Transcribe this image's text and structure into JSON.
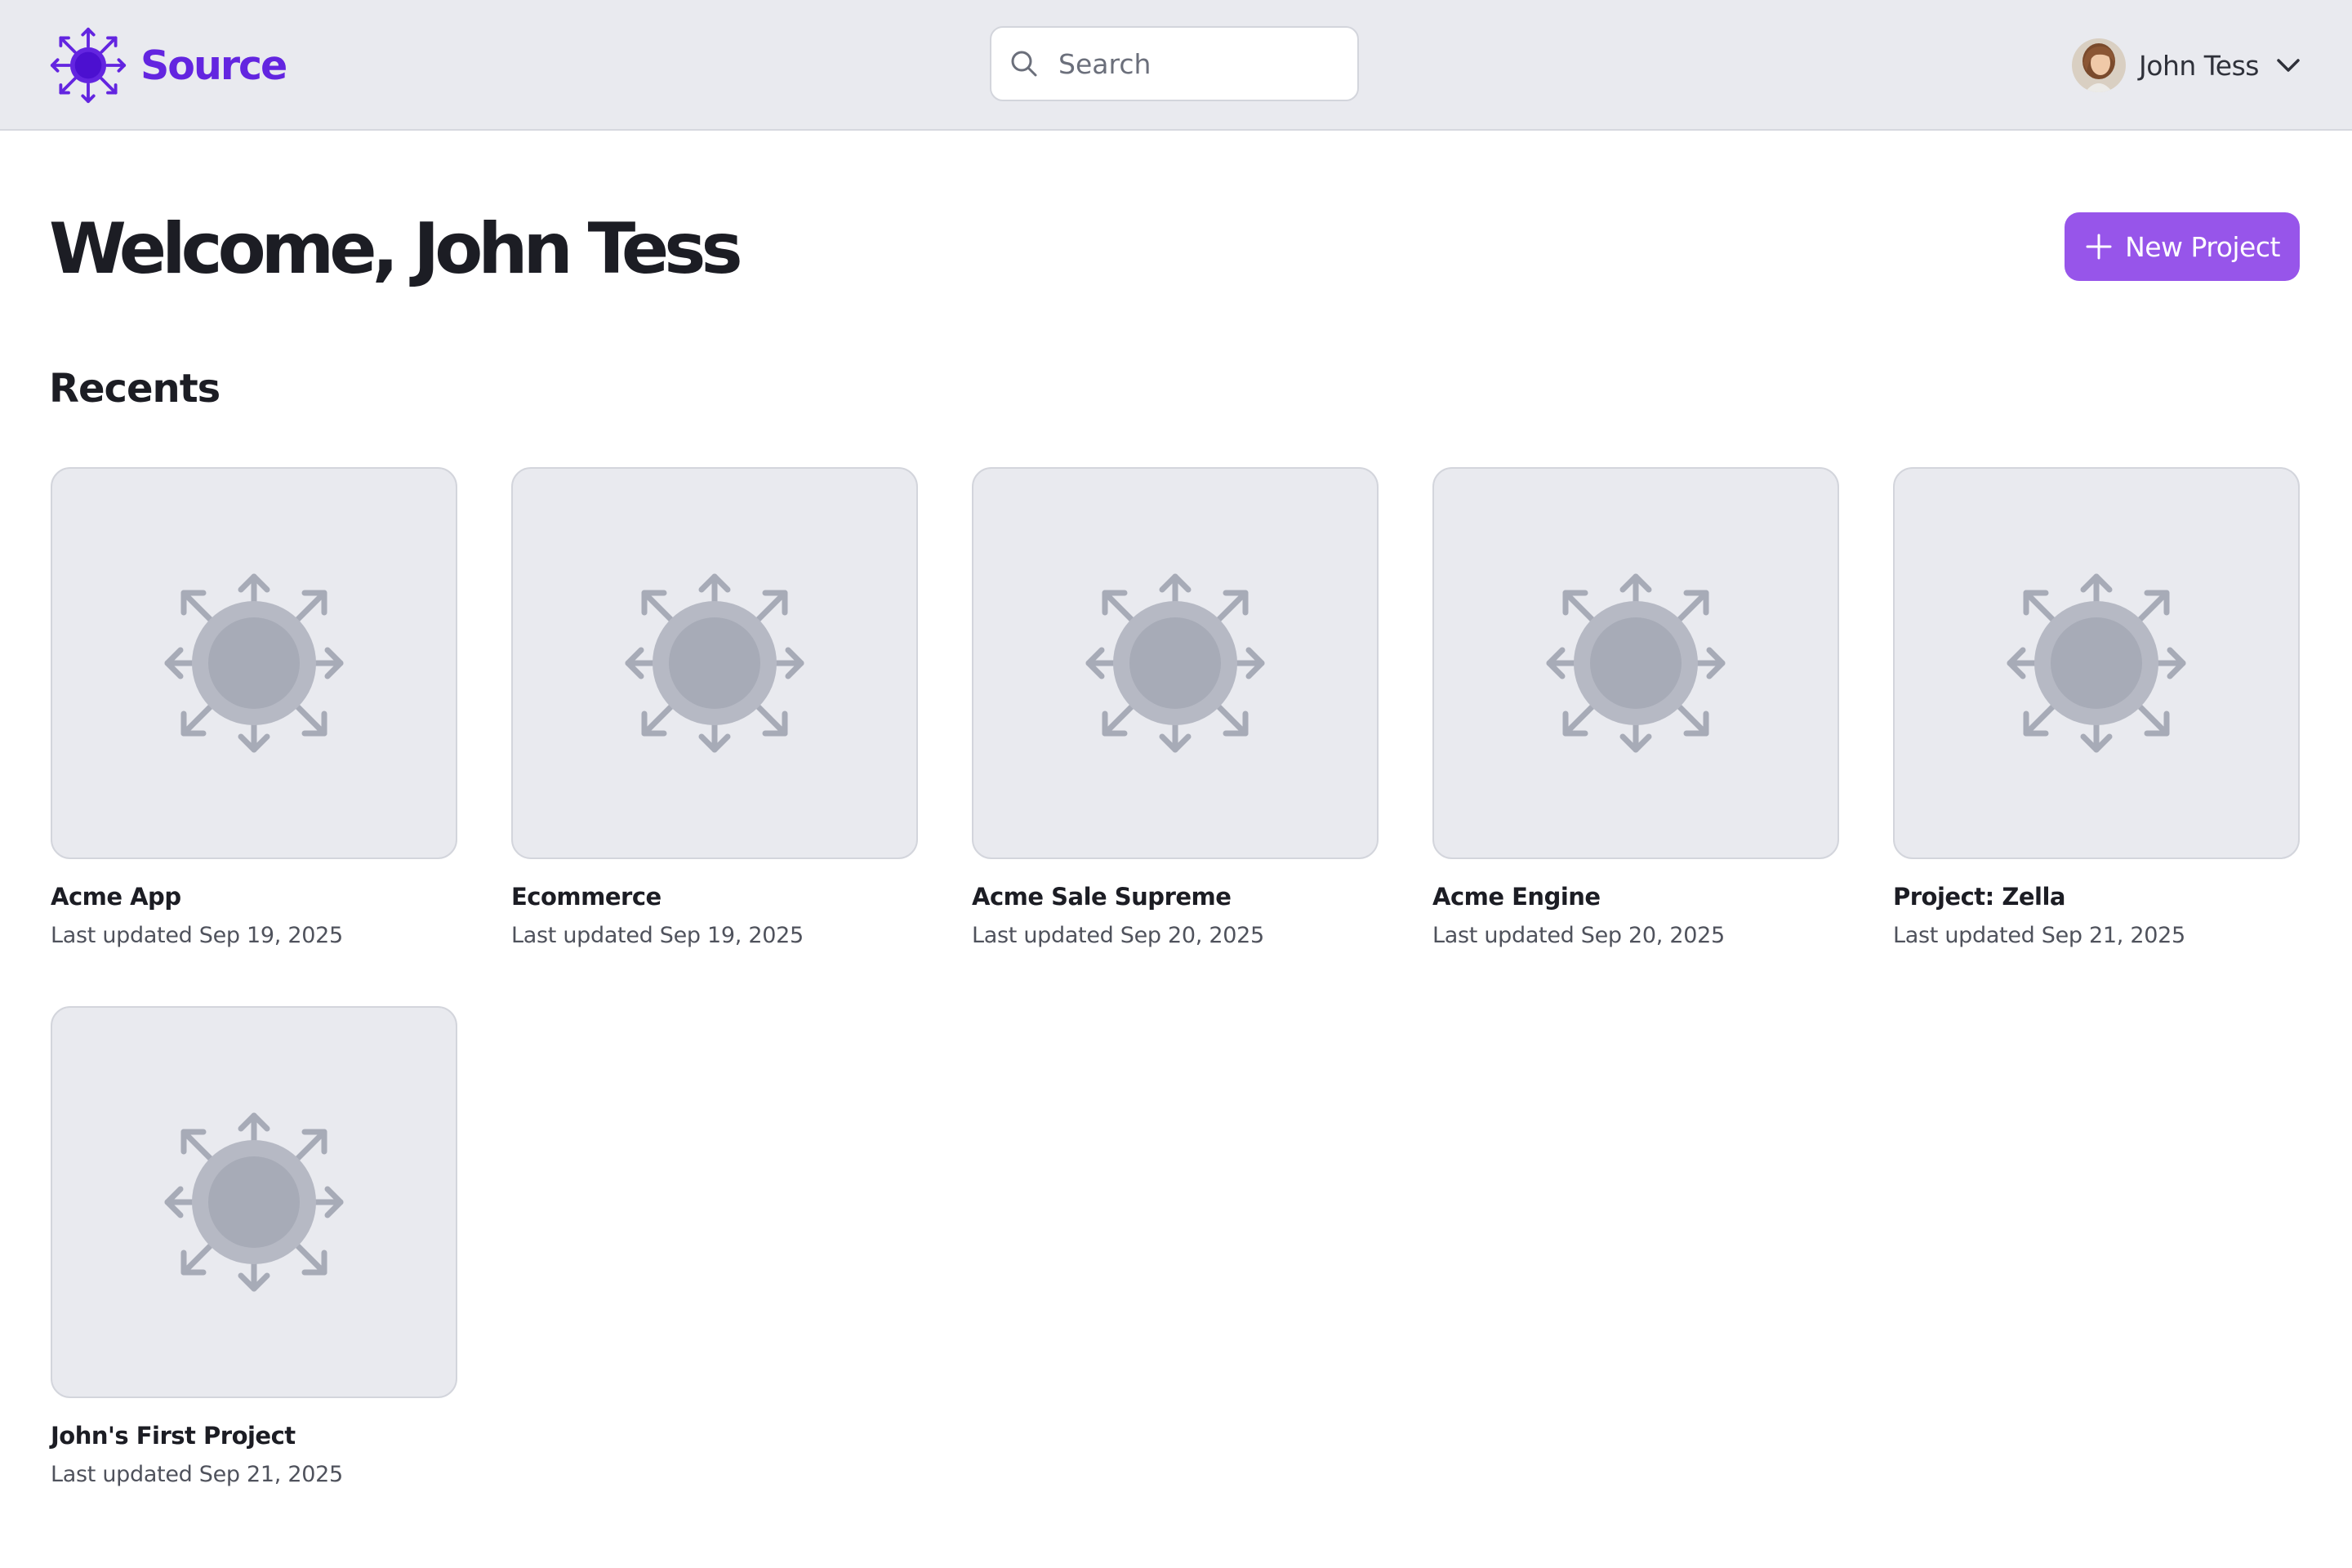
{
  "header": {
    "logo_text": "Source",
    "brand_color": "#6325e0",
    "search_placeholder": "Search",
    "search_value": "",
    "user_name": "John Tess"
  },
  "main": {
    "title": "Welcome, John Tess",
    "new_project_label": "New Project",
    "new_project_color": "#9755ea",
    "recents_title": "Recents",
    "projects": [
      {
        "name": "Acme App",
        "updated": "Last updated Sep 19, 2025",
        "icon": "placeholder-burst-icon"
      },
      {
        "name": "Ecommerce",
        "updated": "Last updated Sep 19, 2025",
        "icon": "placeholder-burst-icon"
      },
      {
        "name": "Acme Sale Supreme",
        "updated": "Last updated Sep 20, 2025",
        "icon": "placeholder-burst-icon"
      },
      {
        "name": "Acme Engine",
        "updated": "Last updated Sep 20, 2025",
        "icon": "placeholder-burst-icon"
      },
      {
        "name": "Project: Zella",
        "updated": "Last updated Sep 21, 2025",
        "icon": "placeholder-burst-icon"
      },
      {
        "name": "John's First Project",
        "updated": "Last updated Sep 21, 2025",
        "icon": "placeholder-burst-icon"
      }
    ]
  },
  "icons": {
    "logo": "source-logo-icon",
    "search": "search-icon",
    "dropdown": "chevron-down-icon",
    "add": "plus-icon"
  }
}
